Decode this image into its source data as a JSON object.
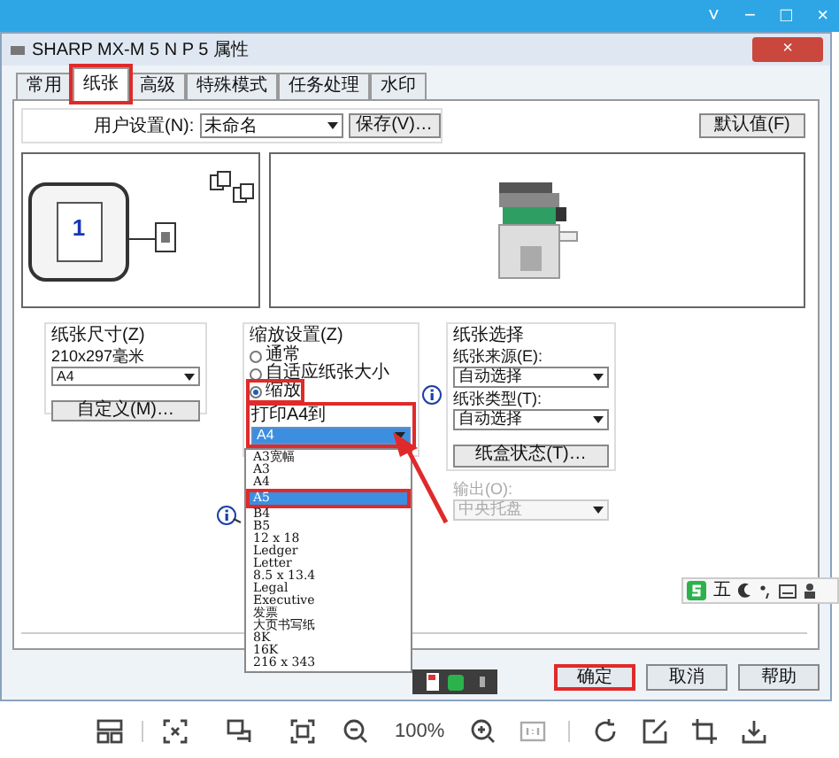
{
  "viewer_window": {
    "controls": [
      "˅",
      "−",
      "□",
      "×"
    ]
  },
  "dialog": {
    "title": "SHARP MX-M 5 N P 5 属性",
    "close": "×"
  },
  "tabs": [
    {
      "label": "常用",
      "selected": false,
      "annotated": false
    },
    {
      "label": "纸张",
      "selected": true,
      "annotated": true
    },
    {
      "label": "高级",
      "selected": false,
      "annotated": false
    },
    {
      "label": "特殊模式",
      "selected": false,
      "annotated": false
    },
    {
      "label": "任务处理",
      "selected": false,
      "annotated": false
    },
    {
      "label": "水印",
      "selected": false,
      "annotated": false
    }
  ],
  "user_settings": {
    "label": "用户设置(N):",
    "value": "未命名",
    "save_button": "保存(V)…",
    "default_button": "默认值(F)"
  },
  "preview": {
    "page_number": "1"
  },
  "paper_size": {
    "title": "纸张尺寸(Z)",
    "dimensions": "210x297毫米",
    "value": "A4",
    "custom_button": "自定义(M)…"
  },
  "scaling": {
    "title": "缩放设置(Z)",
    "options": [
      {
        "label": "通常",
        "selected": false,
        "annotated": false
      },
      {
        "label": "自适应纸张大小",
        "selected": false,
        "annotated": false
      },
      {
        "label": "缩放",
        "selected": true,
        "annotated": true
      }
    ],
    "print_label": "打印A4到",
    "value": "A4",
    "annotated": true,
    "dropdown": {
      "expanded": true,
      "items": [
        {
          "label": "A3宽幅",
          "selected": false,
          "annotated": false
        },
        {
          "label": "A3",
          "selected": false,
          "annotated": false
        },
        {
          "label": "A4",
          "selected": false,
          "annotated": false
        },
        {
          "label": "A5",
          "selected": true,
          "annotated": true
        },
        {
          "label": "B4",
          "selected": false,
          "annotated": false
        },
        {
          "label": "B5",
          "selected": false,
          "annotated": false
        },
        {
          "label": "12 x 18",
          "selected": false,
          "annotated": false
        },
        {
          "label": "Ledger",
          "selected": false,
          "annotated": false
        },
        {
          "label": "Letter",
          "selected": false,
          "annotated": false
        },
        {
          "label": "8.5 x 13.4",
          "selected": false,
          "annotated": false
        },
        {
          "label": "Legal",
          "selected": false,
          "annotated": false
        },
        {
          "label": "Executive",
          "selected": false,
          "annotated": false
        },
        {
          "label": "发票",
          "selected": false,
          "annotated": false
        },
        {
          "label": "大页书写纸",
          "selected": false,
          "annotated": false
        },
        {
          "label": "8K",
          "selected": false,
          "annotated": false
        },
        {
          "label": "16K",
          "selected": false,
          "annotated": false
        },
        {
          "label": "216 x 343",
          "selected": false,
          "annotated": false
        }
      ]
    }
  },
  "paper_selection": {
    "title": "纸张选择",
    "source_label": "纸张来源(E):",
    "source_value": "自动选择",
    "type_label": "纸张类型(T):",
    "type_value": "自动选择",
    "tray_button": "纸盒状态(T)…"
  },
  "output": {
    "label": "输出(O):",
    "value": "中央托盘",
    "disabled": true
  },
  "ime_bar": {
    "mode": "五"
  },
  "buttons": [
    {
      "label": "确定",
      "annotated": true
    },
    {
      "label": "取消",
      "annotated": false
    },
    {
      "label": "帮助",
      "annotated": false
    }
  ],
  "viewer_toolbar": {
    "zoom": "100%"
  }
}
